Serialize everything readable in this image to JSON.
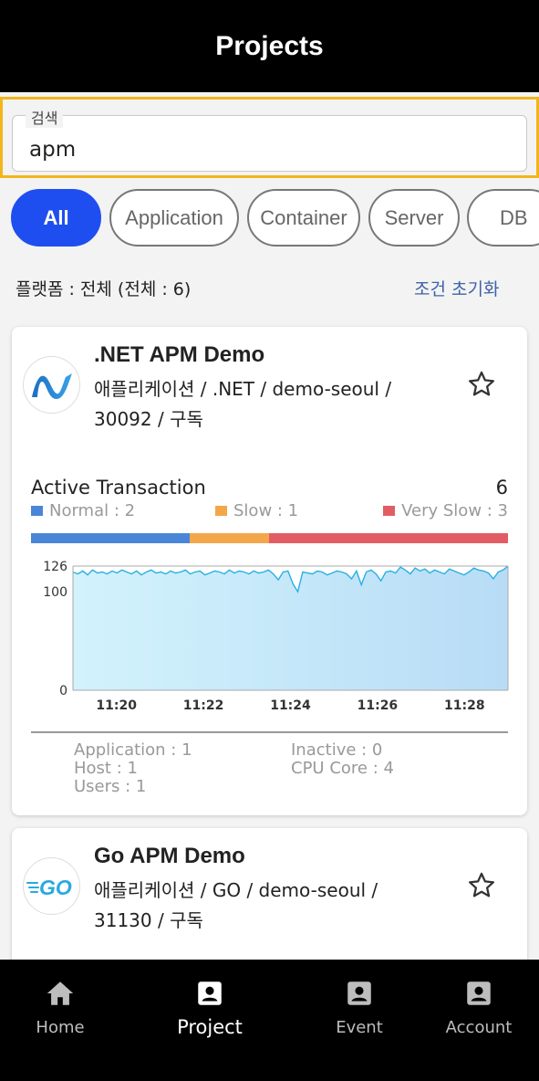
{
  "header": {
    "title": "Projects"
  },
  "search": {
    "label": "검색",
    "value": "apm"
  },
  "chips": [
    {
      "label": "All",
      "active": true
    },
    {
      "label": "Application",
      "active": false
    },
    {
      "label": "Container",
      "active": false
    },
    {
      "label": "Server",
      "active": false
    },
    {
      "label": "DB",
      "active": false
    }
  ],
  "filter": {
    "summary": "플랫폼 : 전체 (전체 : 6)",
    "reset_label": "조건 초기화"
  },
  "projects": [
    {
      "name": ".NET APM Demo",
      "meta_line1": "애플리케이션 / .NET / demo-seoul /",
      "meta_line2": "30092 / 구독",
      "logo_icon": "dotnet-logo-icon",
      "favorite_icon": "star-outline-icon",
      "active_transaction_label": "Active Transaction",
      "active_transaction_total": "6",
      "legend": {
        "normal": "Normal : 2",
        "slow": "Slow : 1",
        "very_slow": "Very Slow : 3"
      },
      "status_counts": {
        "normal": 2,
        "slow": 1,
        "very_slow": 3
      },
      "colors": {
        "normal": "#4a86d8",
        "slow": "#f3a64a",
        "very_slow": "#e25d63",
        "line": "#2ab0e0"
      },
      "stats": {
        "application": "Application : 1",
        "inactive": "Inactive : 0",
        "host": "Host : 1",
        "cpu_core": "CPU Core : 4",
        "users": "Users : 1"
      }
    },
    {
      "name": "Go APM Demo",
      "meta_line1": "애플리케이션 / GO / demo-seoul /",
      "meta_line2": "31130 / 구독",
      "logo_icon": "go-logo-icon",
      "logo_text": "GO",
      "favorite_icon": "star-outline-icon"
    }
  ],
  "chart_data": {
    "type": "area",
    "y_ticks": [
      "0",
      "100",
      "126"
    ],
    "x_ticks": [
      "11:20",
      "11:22",
      "11:24",
      "11:26",
      "11:28"
    ],
    "ylim": [
      0,
      126
    ],
    "x_range": [
      "11:19",
      "11:29"
    ],
    "grid": false,
    "series": [
      {
        "values": [
          120,
          118,
          121,
          117,
          122,
          119,
          120,
          118,
          121,
          119,
          122,
          120,
          118,
          121,
          117,
          120,
          122,
          119,
          120,
          118,
          121,
          119,
          120,
          122,
          118,
          120,
          121,
          117,
          119,
          121,
          120,
          118,
          122,
          119,
          121,
          120,
          118,
          121,
          119,
          120,
          122,
          118,
          112,
          120,
          121,
          108,
          100,
          120,
          119,
          118,
          121,
          120,
          117,
          119,
          121,
          120,
          118,
          113,
          121,
          107,
          120,
          122,
          118,
          111,
          120,
          121,
          119,
          125,
          122,
          118,
          124,
          121,
          123,
          119,
          122,
          120,
          118,
          123,
          121,
          119,
          117,
          120,
          124,
          122,
          121,
          119,
          113,
          120,
          122,
          126
        ]
      }
    ]
  },
  "nav": [
    {
      "label": "Home",
      "icon": "home-icon",
      "active": false
    },
    {
      "label": "Project",
      "icon": "project-badge-icon",
      "active": true
    },
    {
      "label": "Event",
      "icon": "event-badge-icon",
      "active": false
    },
    {
      "label": "Account",
      "icon": "account-badge-icon",
      "active": false
    }
  ]
}
